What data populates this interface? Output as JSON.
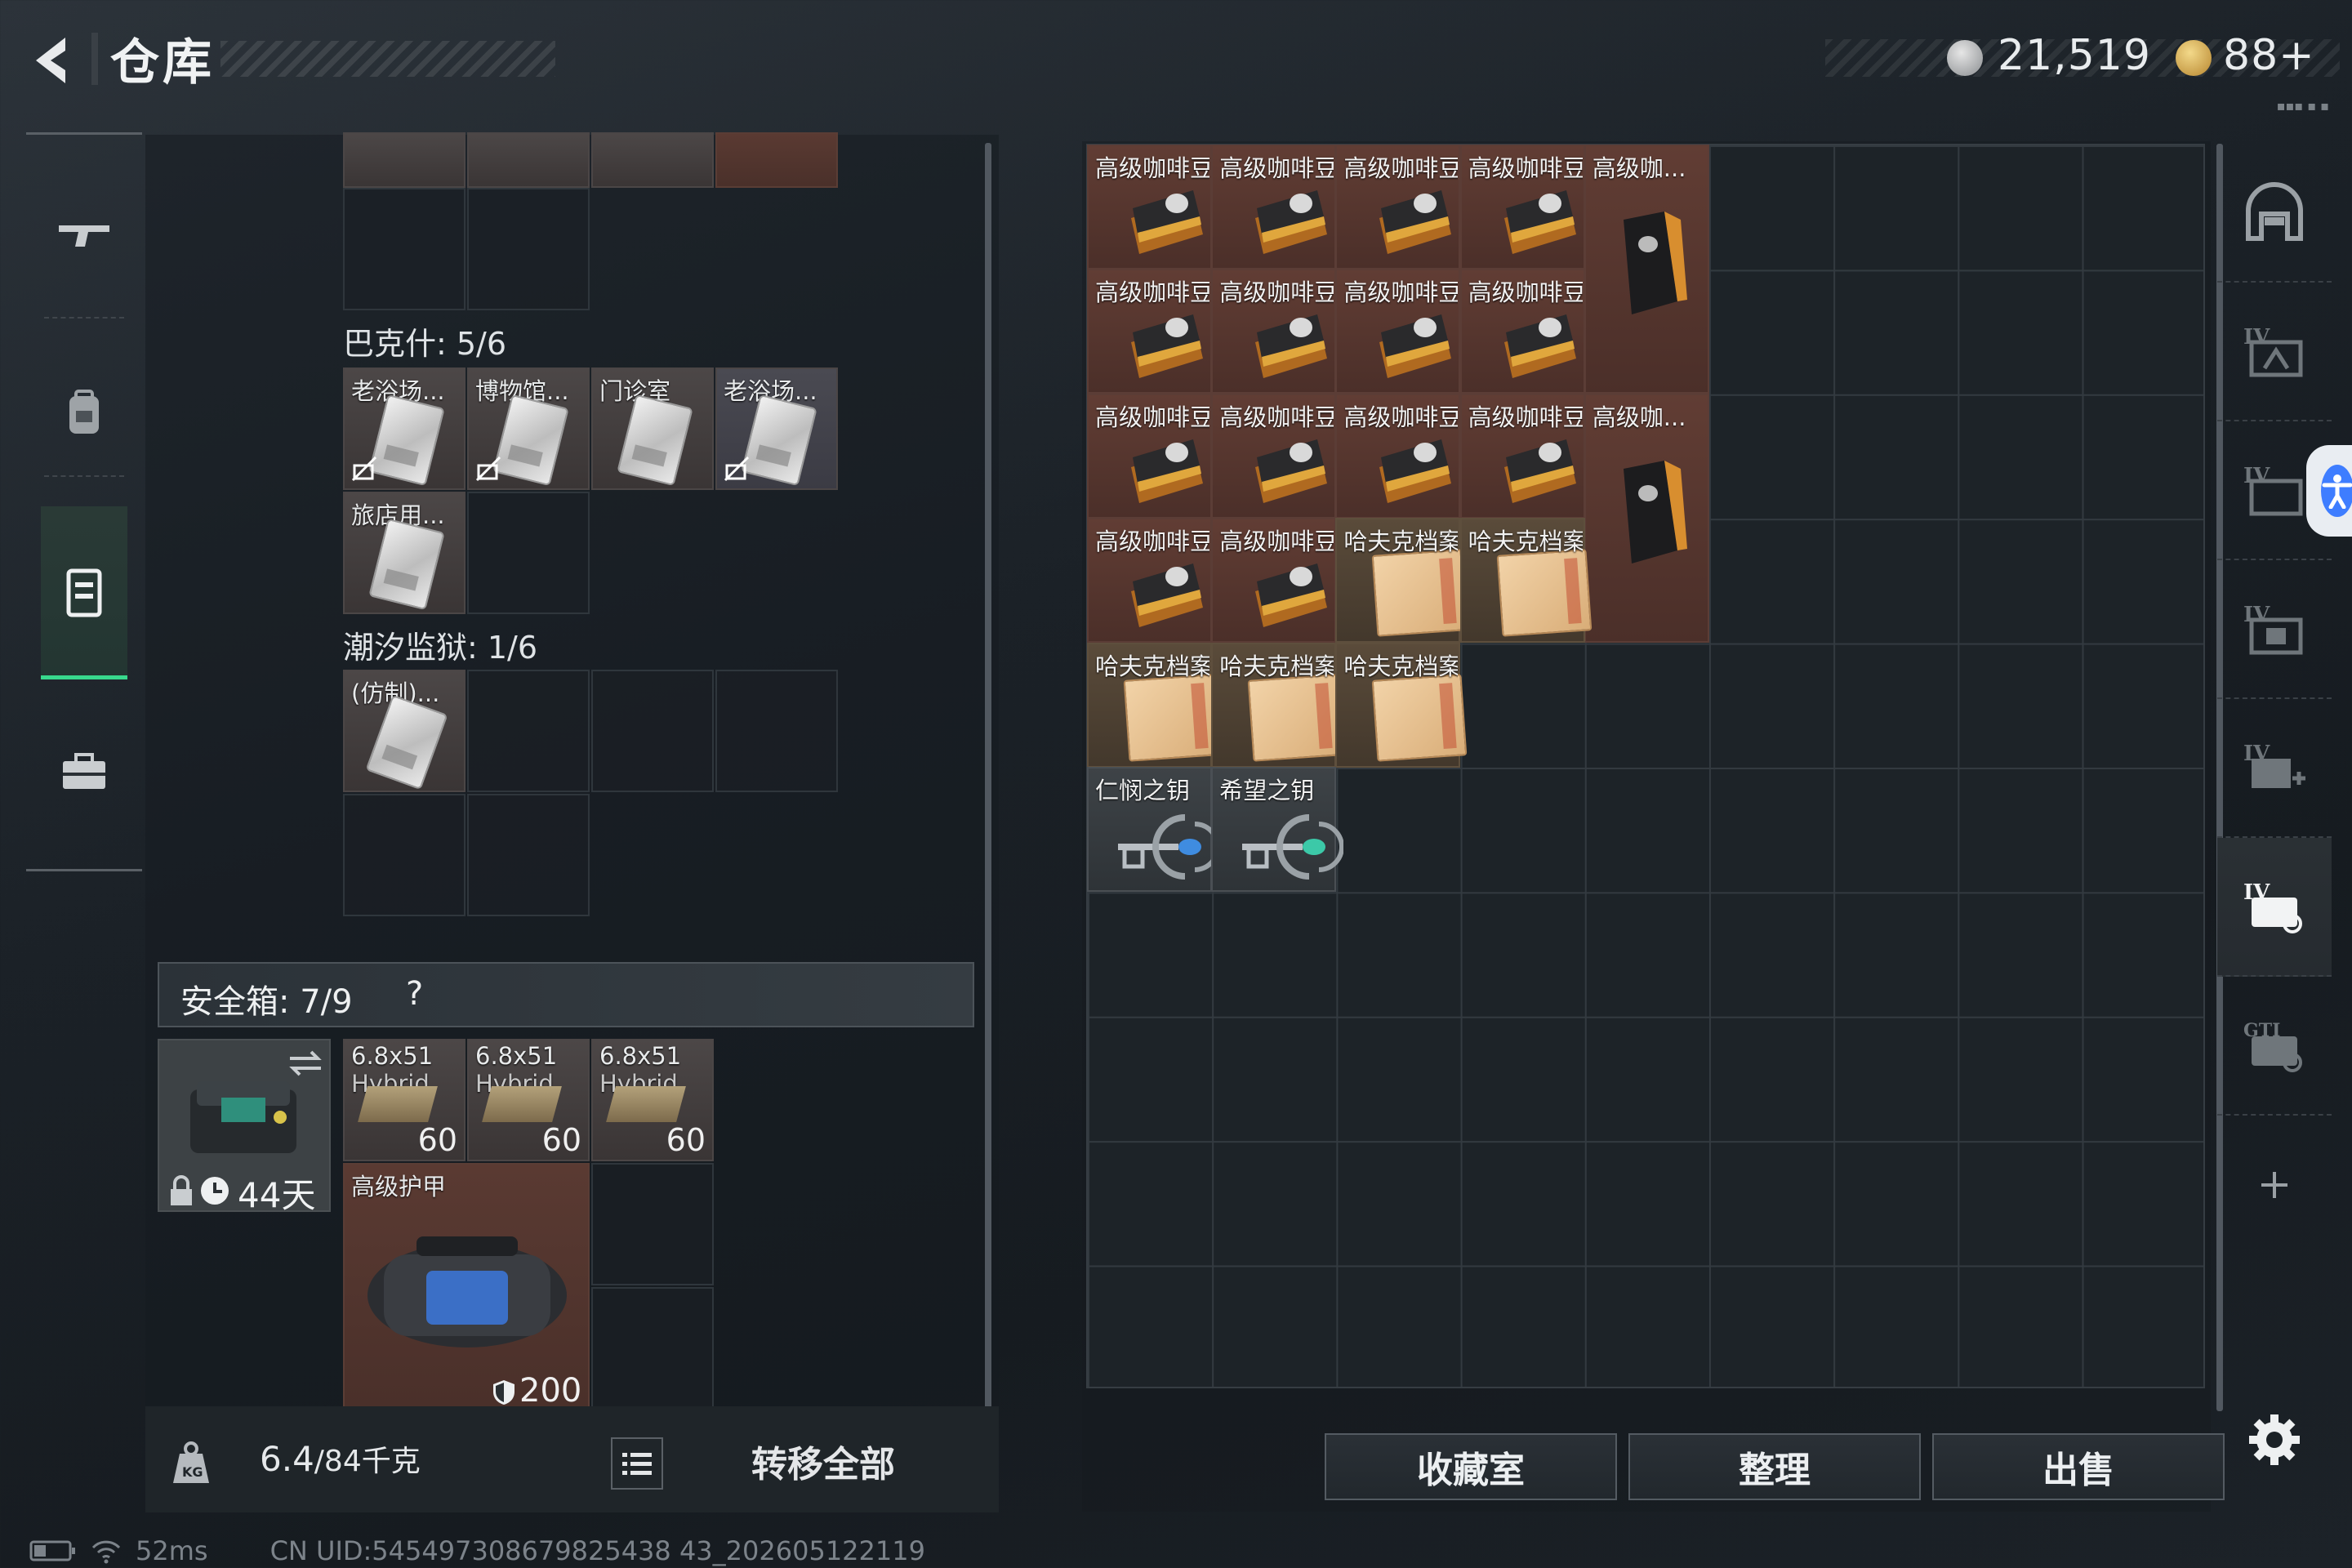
{
  "header": {
    "title": "仓库",
    "coins": "21,519",
    "tokens": "88+"
  },
  "colors": {
    "accent_green": "#38d98d",
    "item_red": "#5a3a32",
    "item_file": "#5a4b3a",
    "a11y_blue": "#3e7dff"
  },
  "left_nav": [
    {
      "icon": "rifle-icon"
    },
    {
      "icon": "backpack-icon"
    },
    {
      "icon": "chest-rig-icon"
    },
    {
      "icon": "briefcase-icon"
    }
  ],
  "containers": {
    "bakesh": {
      "label": "巴克什: 5/6",
      "items": [
        "老浴场...",
        "博物馆...",
        "门诊室",
        "老浴场...",
        "旅店用..."
      ]
    },
    "tidal": {
      "label": "潮汐监狱: 1/6",
      "items": [
        "(仿制)..."
      ]
    }
  },
  "safe": {
    "label": "安全箱: 7/9",
    "help": "?",
    "duration": "44天",
    "ammo": [
      {
        "name": "6.8x51",
        "sub": "Hybrid",
        "count": "60"
      },
      {
        "name": "6.8x51",
        "sub": "Hybrid",
        "count": "60"
      },
      {
        "name": "6.8x51",
        "sub": "Hybrid",
        "count": "60"
      }
    ],
    "armor": {
      "name": "高级护甲",
      "durability": "200"
    }
  },
  "bottom": {
    "weight": "6.4",
    "weight_max": "/84千克",
    "transfer": "转移全部"
  },
  "stash": {
    "coffee": "高级咖啡豆",
    "coffee_short": "高级咖...",
    "file": "哈夫克档案",
    "key1": "仁悯之钥",
    "key2": "希望之钥"
  },
  "buttons": {
    "collection": "收藏室",
    "organize": "整理",
    "sell": "出售"
  },
  "status": {
    "ping": "52ms",
    "uid": "CN UID:545497308679825438 43_202605122119"
  }
}
